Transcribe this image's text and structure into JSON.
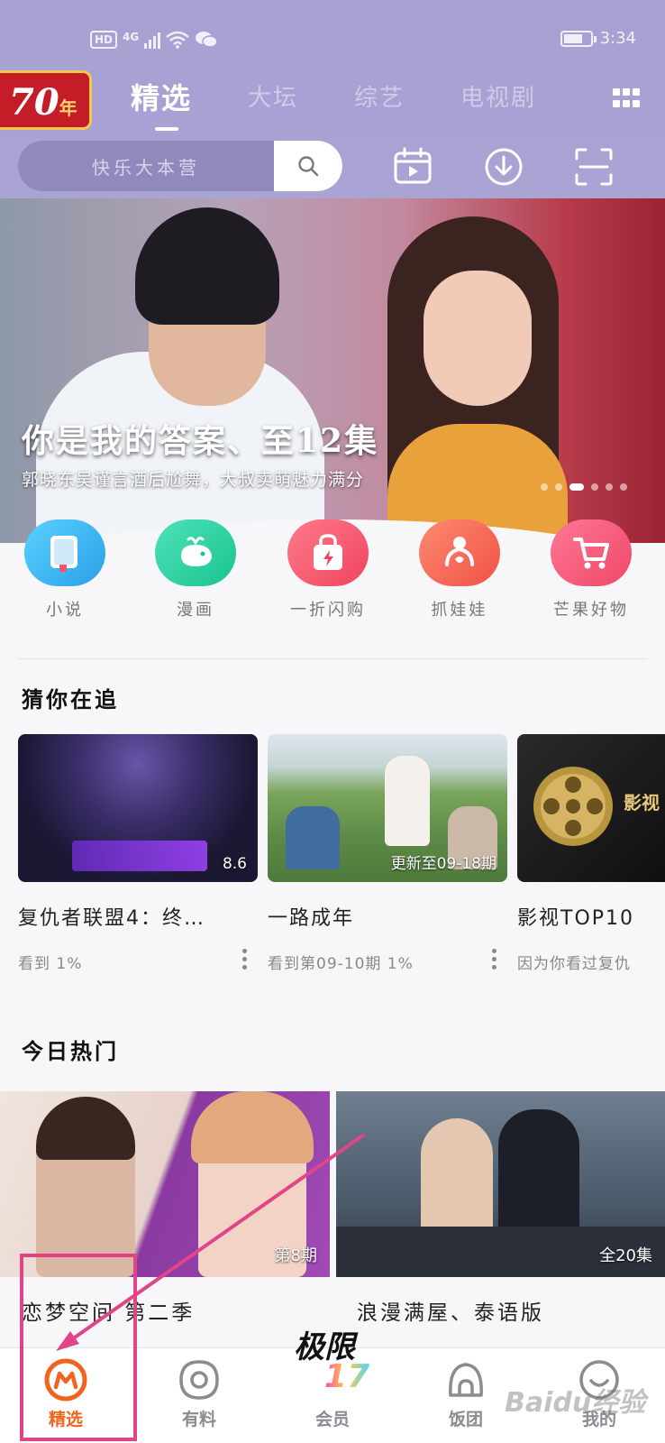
{
  "status_bar": {
    "hd": "HD",
    "network": "4G",
    "time": "3:34"
  },
  "header": {
    "badge": {
      "number": "70",
      "suffix": "年"
    },
    "tabs": [
      {
        "label": "精选",
        "active": true
      },
      {
        "label": "大坛",
        "active": false
      },
      {
        "label": "综艺",
        "active": false
      },
      {
        "label": "电视剧",
        "active": false
      }
    ],
    "search": {
      "placeholder": "快乐大本营"
    }
  },
  "hero": {
    "title": "你是我的答案、至12集",
    "subtitle": "郭晓东吴谨言酒后尬舞，大叔卖萌魅力满分",
    "slide_count": 6,
    "active_slide": 3
  },
  "shortcuts": [
    {
      "label": "小说",
      "icon": "book-icon",
      "color": "#3bb3ef"
    },
    {
      "label": "漫画",
      "icon": "whale-icon",
      "color": "#2fd3a1"
    },
    {
      "label": "一折闪购",
      "icon": "shopping-bag-icon",
      "color": "#f2566b"
    },
    {
      "label": "抓娃娃",
      "icon": "claw-icon",
      "color": "#f4685a"
    },
    {
      "label": "芒果好物",
      "icon": "cart-icon",
      "color": "#f45877"
    }
  ],
  "watching": {
    "title": "猜你在追",
    "items": [
      {
        "title": "复仇者联盟4：终…",
        "badge": "8.6",
        "meta": "看到 1%"
      },
      {
        "title": "一路成年",
        "badge": "更新至09-18期",
        "meta": "看到第09-10期 1%"
      },
      {
        "title": "影视TOP10",
        "badge": "影视",
        "meta": "因为你看过复仇"
      }
    ]
  },
  "hot": {
    "title": "今日热门",
    "items": [
      {
        "title": "恋梦空间 第二季",
        "badge": "第8期"
      },
      {
        "title": "浪漫满屋、泰语版",
        "badge": "全20集"
      }
    ]
  },
  "bottom_nav": [
    {
      "label": "精选",
      "icon": "mango-logo-icon",
      "active": true
    },
    {
      "label": "有料",
      "icon": "eye-icon",
      "active": false
    },
    {
      "label": "会员",
      "icon": "vip-icon",
      "active": false
    },
    {
      "label": "饭团",
      "icon": "rice-ball-icon",
      "active": false
    },
    {
      "label": "我的",
      "icon": "profile-icon",
      "active": false
    }
  ],
  "vip_logo": {
    "text": "极限",
    "number": "17"
  },
  "watermark": "Baidu经验",
  "colors": {
    "accent": "#f0641e",
    "header_bg": "#a7a1d3",
    "annotation": "#e0458a"
  }
}
